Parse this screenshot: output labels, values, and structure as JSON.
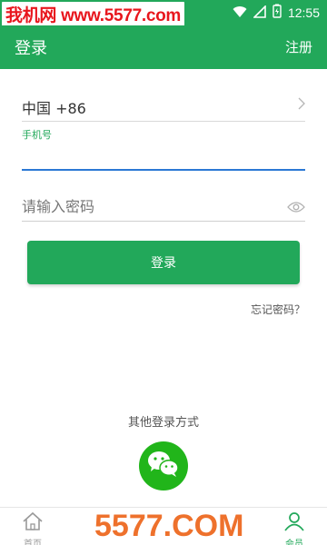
{
  "status_bar": {
    "watermark": "我机网 www.5577.com",
    "time": "12:55",
    "icons": [
      "wifi-icon",
      "signal-icon",
      "battery-icon"
    ]
  },
  "app_bar": {
    "title": "登录",
    "action": "注册"
  },
  "form": {
    "country": "中国 +86",
    "phone_label": "手机号",
    "phone_value": "",
    "password_placeholder": "请输入密码",
    "login_button": "登录",
    "forgot_password": "忘记密码？"
  },
  "other_login": {
    "title": "其他登录方式",
    "wechat_icon": "wechat-icon"
  },
  "bottom_nav": {
    "items": [
      {
        "label": "首页",
        "icon": "home-icon",
        "active": false
      },
      {
        "label": "会员",
        "icon": "user-icon",
        "active": true
      }
    ]
  },
  "watermark_bottom": "5577.COM",
  "colors": {
    "primary": "#22a85a",
    "watermark_red": "#e8161d",
    "watermark_orange": "#ee6a21",
    "focus_line": "#2b78d4"
  }
}
